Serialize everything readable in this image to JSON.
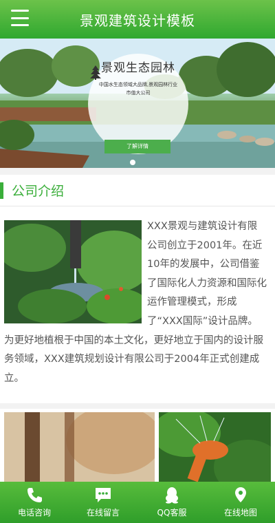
{
  "header": {
    "title": "景观建筑设计模板",
    "menu_icon": "hamburger-menu-icon"
  },
  "banner": {
    "title": "景观生态园林",
    "subtitle": "中国水生态领域大品牌,景观园林行业市值大公司",
    "button_label": "了解详情",
    "icon": "pine-tree-icon",
    "slides_count": 1,
    "active_slide": 1
  },
  "intro": {
    "heading": "公司介绍",
    "text": "XXX景观与建筑设计有限公司创立于2001年。在近10年的发展中，公司借鉴了国际化人力资源和国际化运作管理模式，形成了“XXX国际”设计品牌。为更好地植根于中国的本土文化，更好地立于国内的设计服务领域，XXX建筑规划设计有限公司于2004年正式创建成立。"
  },
  "footer": {
    "items": [
      {
        "label": "电话咨询",
        "icon": "phone-icon"
      },
      {
        "label": "在线留言",
        "icon": "message-icon"
      },
      {
        "label": "QQ客服",
        "icon": "qq-icon"
      },
      {
        "label": "在线地图",
        "icon": "map-pin-icon"
      }
    ]
  },
  "colors": {
    "brand_green": "#3aae3a",
    "header_top": "#6cc24a",
    "header_bottom": "#2fa82f"
  }
}
